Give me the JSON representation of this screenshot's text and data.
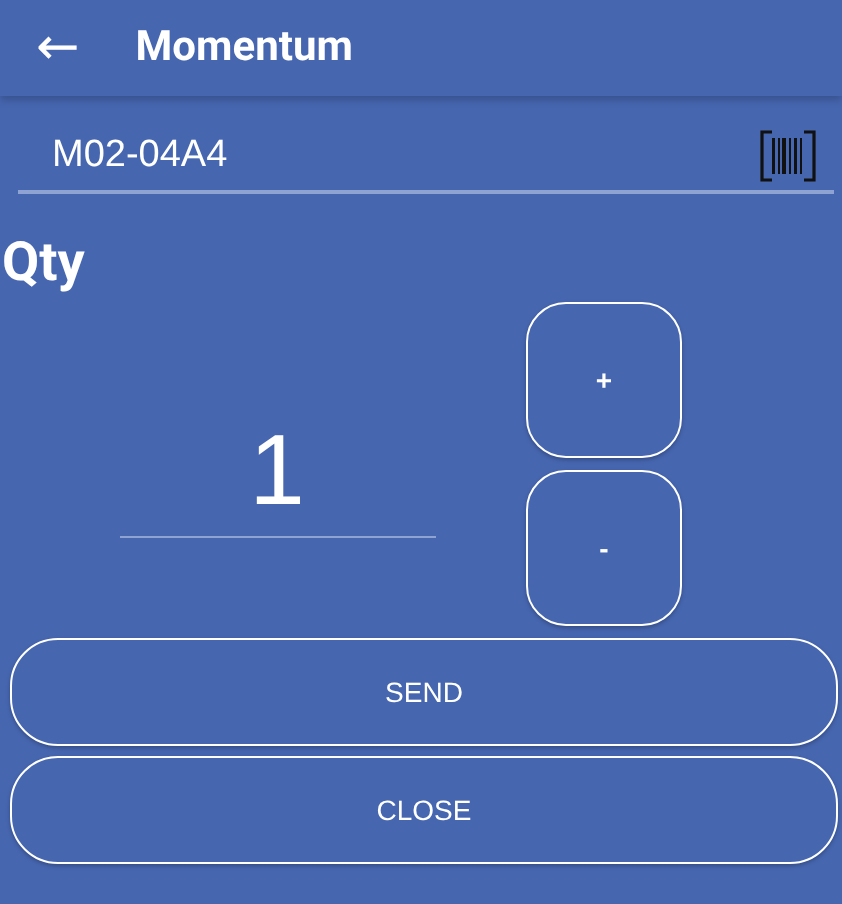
{
  "app_bar": {
    "back": "←",
    "title": "Momentum"
  },
  "location_field": {
    "value": "M02-04A4"
  },
  "qty_label": "Qty",
  "quantity": {
    "value": "1"
  },
  "stepper": [
    "+",
    "-"
  ],
  "buttons": [
    "SEND",
    "CLOSE"
  ]
}
